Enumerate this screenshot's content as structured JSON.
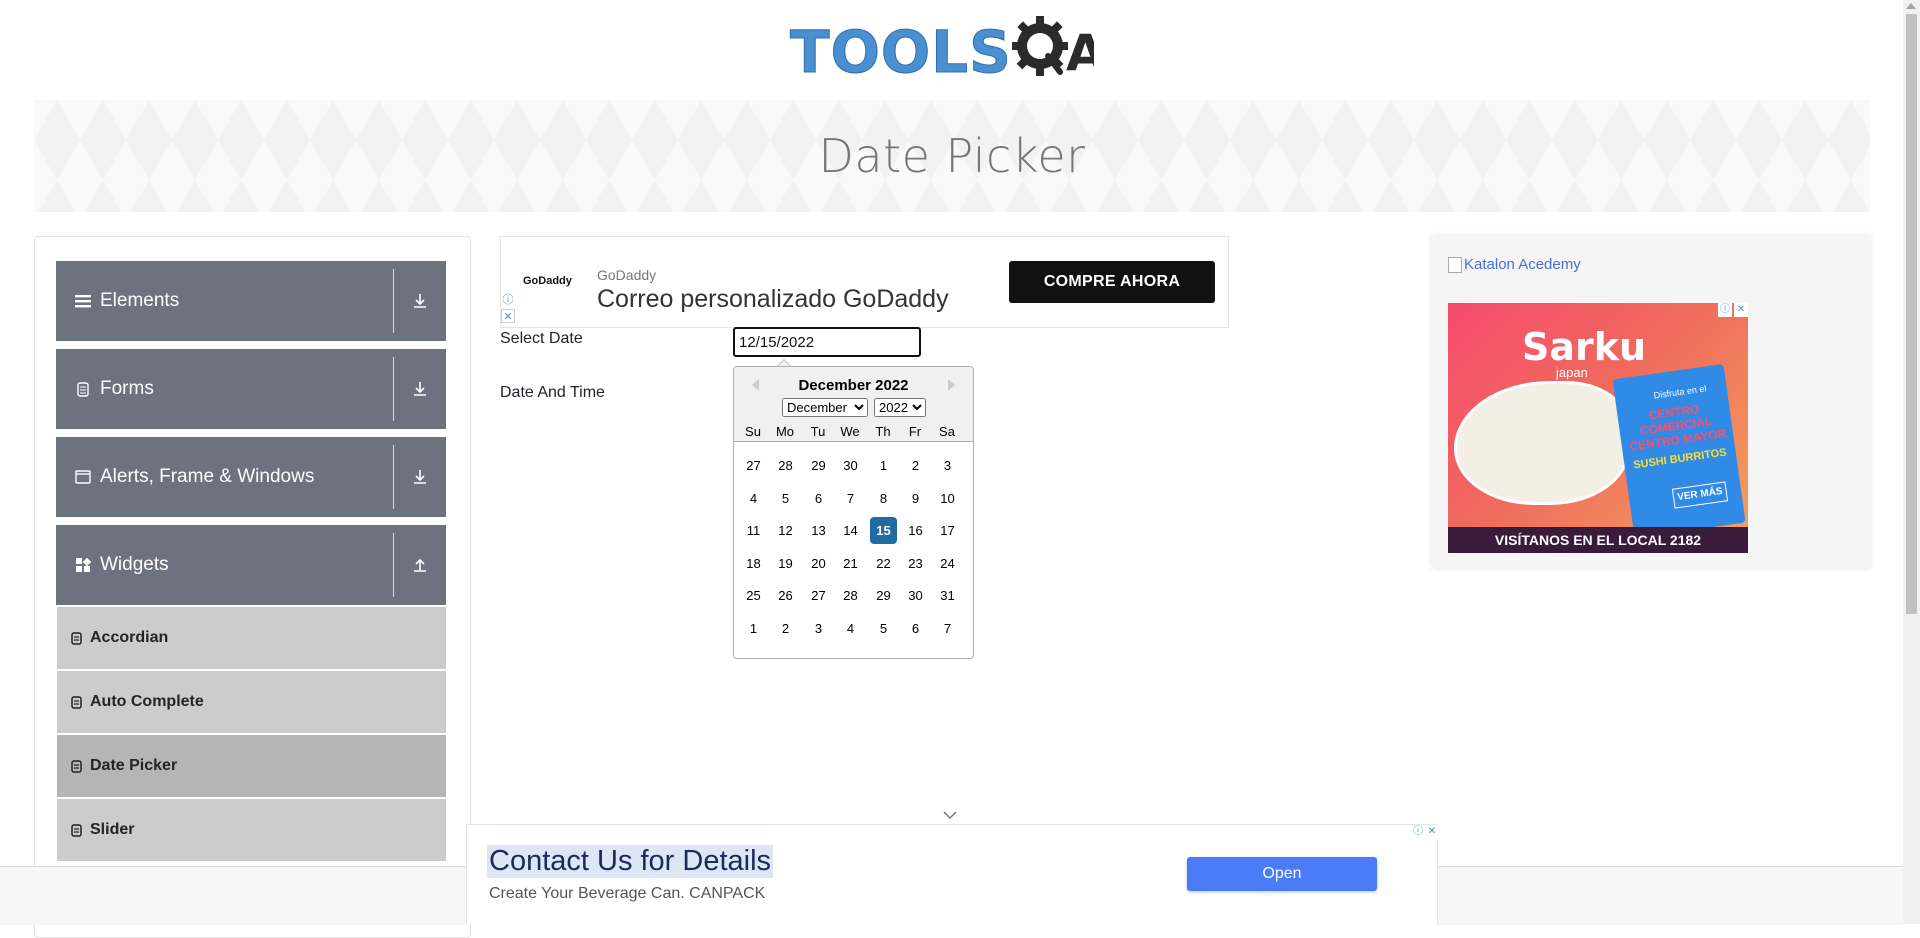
{
  "header": {
    "logo_text": "TOOLS",
    "logo_suffix": "A"
  },
  "banner": {
    "title": "Date Picker"
  },
  "sidebar": {
    "groups": [
      {
        "label": "Elements",
        "icon": "hamburger-icon"
      },
      {
        "label": "Forms",
        "icon": "document-icon"
      },
      {
        "label": "Alerts, Frame & Windows",
        "icon": "window-icon"
      },
      {
        "label": "Widgets",
        "icon": "grid-icon"
      }
    ],
    "widgets_items": [
      {
        "label": "Accordian",
        "active": false
      },
      {
        "label": "Auto Complete",
        "active": false
      },
      {
        "label": "Date Picker",
        "active": true
      },
      {
        "label": "Slider",
        "active": false
      }
    ]
  },
  "ad_top": {
    "logo": "GoDaddy",
    "brand": "GoDaddy",
    "title": "Correo personalizado GoDaddy",
    "button": "COMPRE AHORA"
  },
  "form": {
    "select_date_label": "Select Date",
    "select_date_value": "12/15/2022",
    "date_time_label": "Date And Time"
  },
  "calendar": {
    "title": "December 2022",
    "month_selected": "December",
    "year_selected": "2022",
    "weekdays": [
      "Su",
      "Mo",
      "Tu",
      "We",
      "Th",
      "Fr",
      "Sa"
    ],
    "weeks": [
      [
        "27",
        "28",
        "29",
        "30",
        "1",
        "2",
        "3"
      ],
      [
        "4",
        "5",
        "6",
        "7",
        "8",
        "9",
        "10"
      ],
      [
        "11",
        "12",
        "13",
        "14",
        "15",
        "16",
        "17"
      ],
      [
        "18",
        "19",
        "20",
        "21",
        "22",
        "23",
        "24"
      ],
      [
        "25",
        "26",
        "27",
        "28",
        "29",
        "30",
        "31"
      ],
      [
        "1",
        "2",
        "3",
        "4",
        "5",
        "6",
        "7"
      ]
    ],
    "selected_day": "15",
    "selected_color": "#216ba5"
  },
  "ad_right": {
    "alt_text": "Katalon Acedemy",
    "brand": "Sarku",
    "brand_sub": "japan",
    "line1": "Disfruta en el",
    "line2": "CENTRO COMERCIAL CENTRO MAYOR",
    "line3": "SUSHI BURRITOS",
    "cta": "VER MÁS",
    "bottom": "VISÍTANOS EN EL LOCAL 2182"
  },
  "ad_bottom": {
    "title": "Contact Us for Details",
    "subtitle": "Create Your Beverage Can. CANPACK",
    "button": "Open"
  },
  "colors": {
    "sidebar_group": "#6c737e",
    "sidebar_item": "#cccccc",
    "sidebar_item_active": "#b5b5b5",
    "logo_blue": "#4a8fd0",
    "bottom_button": "#4a7cf7"
  }
}
